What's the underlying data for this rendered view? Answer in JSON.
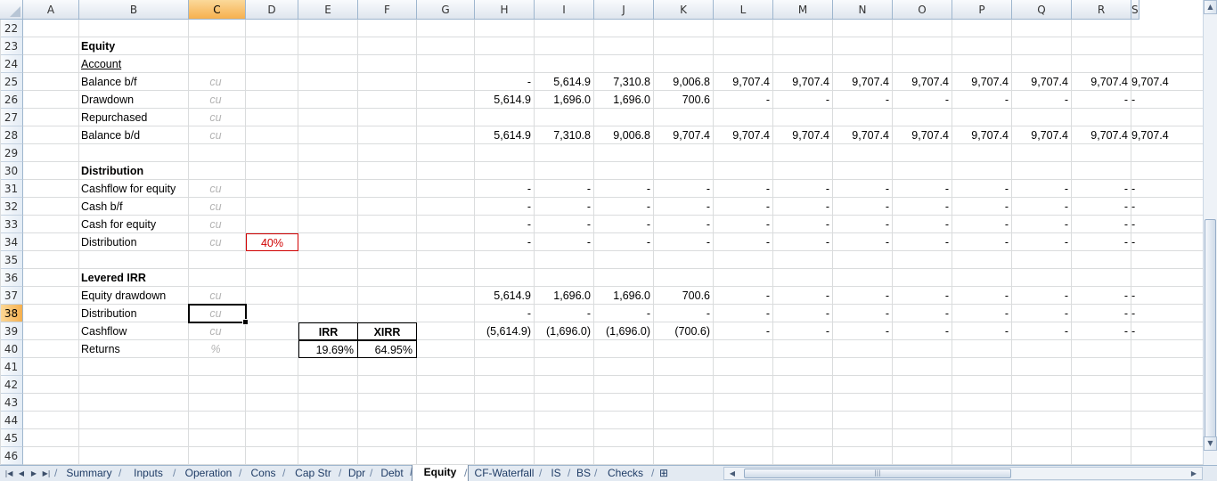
{
  "columns": [
    "A",
    "B",
    "C",
    "D",
    "E",
    "F",
    "G",
    "H",
    "I",
    "J",
    "K",
    "L",
    "M",
    "N",
    "O",
    "P",
    "Q",
    "R",
    "S"
  ],
  "selected_column": "C",
  "rows": [
    "22",
    "23",
    "24",
    "25",
    "26",
    "27",
    "28",
    "29",
    "30",
    "31",
    "32",
    "33",
    "34",
    "35",
    "36",
    "37",
    "38",
    "39",
    "40",
    "41",
    "42",
    "43",
    "44",
    "45",
    "46"
  ],
  "selected_row": "38",
  "sections": {
    "equity": {
      "title": "Equity",
      "account": "Account"
    },
    "distribution": {
      "title": "Distribution"
    },
    "levered_irr": {
      "title": "Levered IRR"
    }
  },
  "labels": {
    "r25": "Balance b/f",
    "r26": "Drawdown",
    "r27": "Repurchased",
    "r28": "Balance b/d",
    "r31": "Cashflow for equity",
    "r32": "Cash b/f",
    "r33": "Cash for equity",
    "r34": "Distribution",
    "r37": "Equity drawdown",
    "r38": "Distribution",
    "r39": "Cashflow",
    "r40": "Returns"
  },
  "units": {
    "r25": "cu",
    "r26": "cu",
    "r27": "cu",
    "r28": "cu",
    "r31": "cu",
    "r32": "cu",
    "r33": "cu",
    "r34": "cu",
    "r37": "cu",
    "r38": "cu",
    "r39": "cu",
    "r40": "%"
  },
  "distribution_rate": "40%",
  "returns_table": {
    "irr_label": "IRR",
    "xirr_label": "XIRR",
    "irr_value": "19.69%",
    "xirr_value": "64.95%"
  },
  "values": {
    "r25": [
      "-",
      "5,614.9",
      "7,310.8",
      "9,006.8",
      "9,707.4",
      "9,707.4",
      "9,707.4",
      "9,707.4",
      "9,707.4",
      "9,707.4",
      "9,707.4",
      "9,707.4"
    ],
    "r26": [
      "5,614.9",
      "1,696.0",
      "1,696.0",
      "700.6",
      "-",
      "-",
      "-",
      "-",
      "-",
      "-",
      "-",
      "-"
    ],
    "r28": [
      "5,614.9",
      "7,310.8",
      "9,006.8",
      "9,707.4",
      "9,707.4",
      "9,707.4",
      "9,707.4",
      "9,707.4",
      "9,707.4",
      "9,707.4",
      "9,707.4",
      "9,707.4"
    ],
    "r31": [
      "-",
      "-",
      "-",
      "-",
      "-",
      "-",
      "-",
      "-",
      "-",
      "-",
      "-",
      "-"
    ],
    "r32": [
      "-",
      "-",
      "-",
      "-",
      "-",
      "-",
      "-",
      "-",
      "-",
      "-",
      "-",
      "-"
    ],
    "r33": [
      "-",
      "-",
      "-",
      "-",
      "-",
      "-",
      "-",
      "-",
      "-",
      "-",
      "-",
      "-"
    ],
    "r34": [
      "-",
      "-",
      "-",
      "-",
      "-",
      "-",
      "-",
      "-",
      "-",
      "-",
      "-",
      "-"
    ],
    "r37": [
      "5,614.9",
      "1,696.0",
      "1,696.0",
      "700.6",
      "-",
      "-",
      "-",
      "-",
      "-",
      "-",
      "-",
      "-"
    ],
    "r38": [
      "-",
      "-",
      "-",
      "-",
      "-",
      "-",
      "-",
      "-",
      "-",
      "-",
      "-",
      "-"
    ],
    "r39": [
      "(5,614.9)",
      "(1,696.0)",
      "(1,696.0)",
      "(700.6)",
      "-",
      "-",
      "-",
      "-",
      "-",
      "-",
      "-",
      "-"
    ]
  },
  "tabs": [
    "Summary",
    "Inputs",
    "Operation",
    "Cons",
    "Cap Str",
    "Dpr",
    "Debt",
    "Equity",
    "CF-Waterfall",
    "IS",
    "BS",
    "Checks"
  ],
  "active_tab": "Equity"
}
